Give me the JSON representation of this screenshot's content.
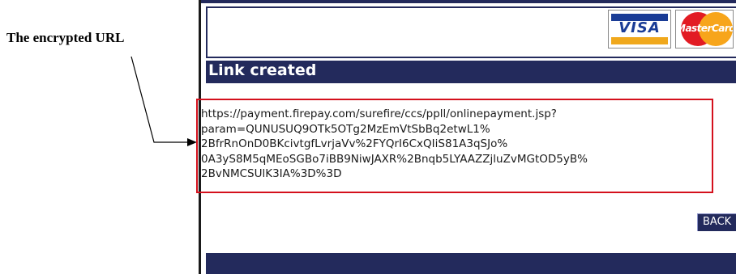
{
  "annotation": {
    "label": "The encrypted URL"
  },
  "header": {
    "card_logos": [
      {
        "name": "visa",
        "text": "VISA",
        "color": "#1a3c96"
      },
      {
        "name": "mastercard",
        "text": "MasterCard",
        "color": "#e21b23"
      }
    ]
  },
  "page": {
    "title": "Link created",
    "url_lines": [
      "https://payment.firepay.com/surefire/ccs/ppll/onlinepayment.jsp?",
      "param=QUNUSUQ9OTk5OTg2MzEmVtSbBq2etwL1%",
      "2BfrRnOnD0BKcivtgfLvrjaVv%2FYQrI6CxQIiS81A3qSJo%",
      "0A3yS8M5qMEoSGBo7iBB9NiwJAXR%2Bnqb5LYAAZZjluZvMGtOD5yB%",
      "2BvNMCSUlK3IA%3D%3D"
    ],
    "back_label": "BACK"
  },
  "colors": {
    "brand_navy": "#232a5c",
    "highlight_red": "#d4101c"
  }
}
